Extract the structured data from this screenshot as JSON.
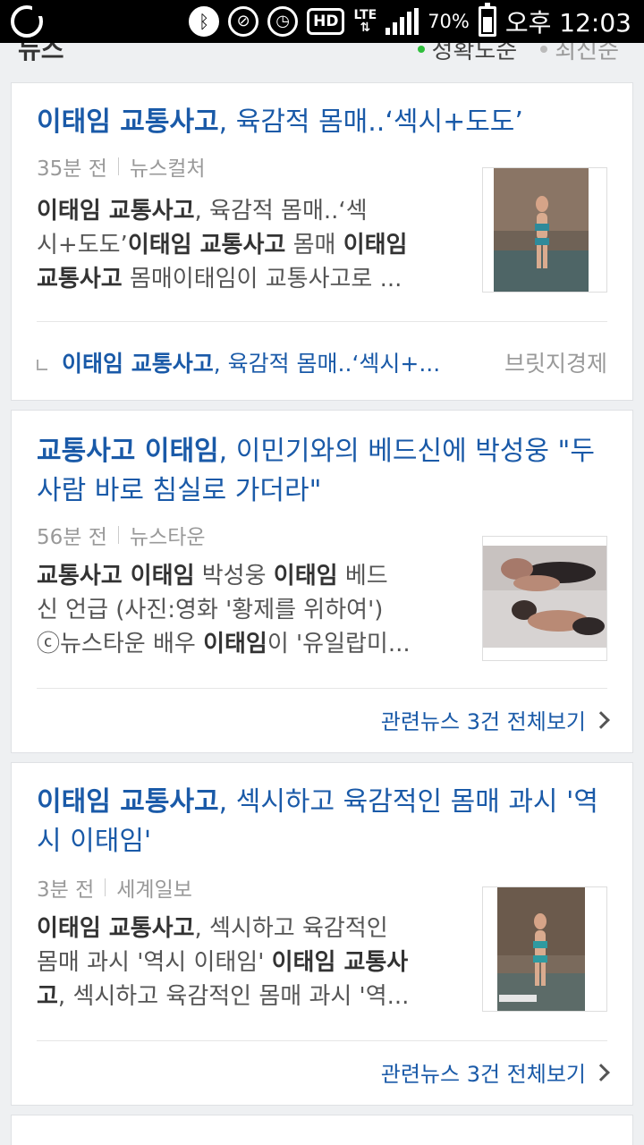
{
  "status_bar": {
    "battery_pct": "70%",
    "lte": "LTE",
    "hd": "HD",
    "time": "오후 12:03",
    "icons": [
      "olleh-logo-icon",
      "bluetooth-icon",
      "mute-icon",
      "alarm-icon",
      "hd-voice-icon",
      "lte-icon",
      "signal-icon",
      "battery-icon"
    ]
  },
  "header": {
    "title": "뉴스",
    "sort_options": [
      {
        "label": "정확도순",
        "active": true
      },
      {
        "label": "최신순",
        "active": false
      }
    ]
  },
  "articles": [
    {
      "title_bold": "이태임 교통사고",
      "title_rest": ", 육감적 몸매..‘섹시+도도’",
      "time": "35분 전",
      "source": "뉴스컬처",
      "snippet_lines": [
        [
          {
            "b": "이태임 교통사고"
          },
          {
            "t": ", 육감적 몸매..‘섹"
          }
        ],
        [
          {
            "t": "시+도도’"
          },
          {
            "b": "이태임 교통사고"
          },
          {
            "t": " 몸매 "
          },
          {
            "b": "이태임"
          }
        ],
        [
          {
            "b": "교통사고"
          },
          {
            "t": " 몸매이태임이 교통사고로 ..."
          }
        ]
      ],
      "related_title_bold": "이태임 교통사고",
      "related_title_rest": ", 육감적 몸매..‘섹시+...",
      "related_source": "브릿지경제"
    },
    {
      "title_bold": "교통사고 이태임",
      "title_rest": ", 이민기와의 베드신에 박성웅 \"두 사람 바로 침실로 가더라\"",
      "time": "56분 전",
      "source": "뉴스타운",
      "snippet_lines": [
        [
          {
            "b": "교통사고 이태임"
          },
          {
            "t": " 박성웅 "
          },
          {
            "b": "이태임"
          },
          {
            "t": " 베드"
          }
        ],
        [
          {
            "t": "신 언급 (사진:영화 '황제를 위하여')"
          }
        ],
        [
          {
            "t": "ⓒ뉴스타운 배우 "
          },
          {
            "b": "이태임"
          },
          {
            "t": "이 '유일랍미..."
          }
        ]
      ],
      "more_label": "관련뉴스 3건 전체보기"
    },
    {
      "title_bold": "이태임 교통사고",
      "title_rest": ", 섹시하고 육감적인 몸매 과시 '역시 이태임'",
      "time": "3분 전",
      "source": "세계일보",
      "snippet_lines": [
        [
          {
            "b": "이태임 교통사고"
          },
          {
            "t": ", 섹시하고 육감적인"
          }
        ],
        [
          {
            "t": "몸매 과시 '역시 이태임' "
          },
          {
            "b": "이태임 교통사"
          }
        ],
        [
          {
            "b": "고"
          },
          {
            "t": ", 섹시하고 육감적인 몸매 과시 '역..."
          }
        ]
      ],
      "more_label": "관련뉴스 3건 전체보기"
    }
  ]
}
